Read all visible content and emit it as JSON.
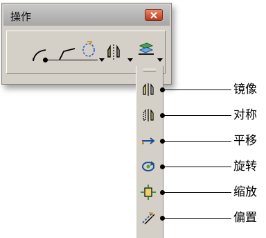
{
  "window": {
    "title": "操作"
  },
  "toolbar": {
    "buttons": [
      {
        "name": "fillet-icon"
      },
      {
        "name": "chamfer-icon"
      },
      {
        "name": "transform-icon"
      },
      {
        "name": "symmetry-icon"
      },
      {
        "name": "analysis-icon"
      }
    ]
  },
  "dropdown": {
    "items": [
      {
        "label": "镜像",
        "icon": "mirror-icon"
      },
      {
        "label": "对称",
        "icon": "symmetry-icon"
      },
      {
        "label": "平移",
        "icon": "translate-icon"
      },
      {
        "label": "旋转",
        "icon": "rotate-icon"
      },
      {
        "label": "缩放",
        "icon": "scale-icon"
      },
      {
        "label": "偏置",
        "icon": "offset-icon"
      }
    ]
  }
}
